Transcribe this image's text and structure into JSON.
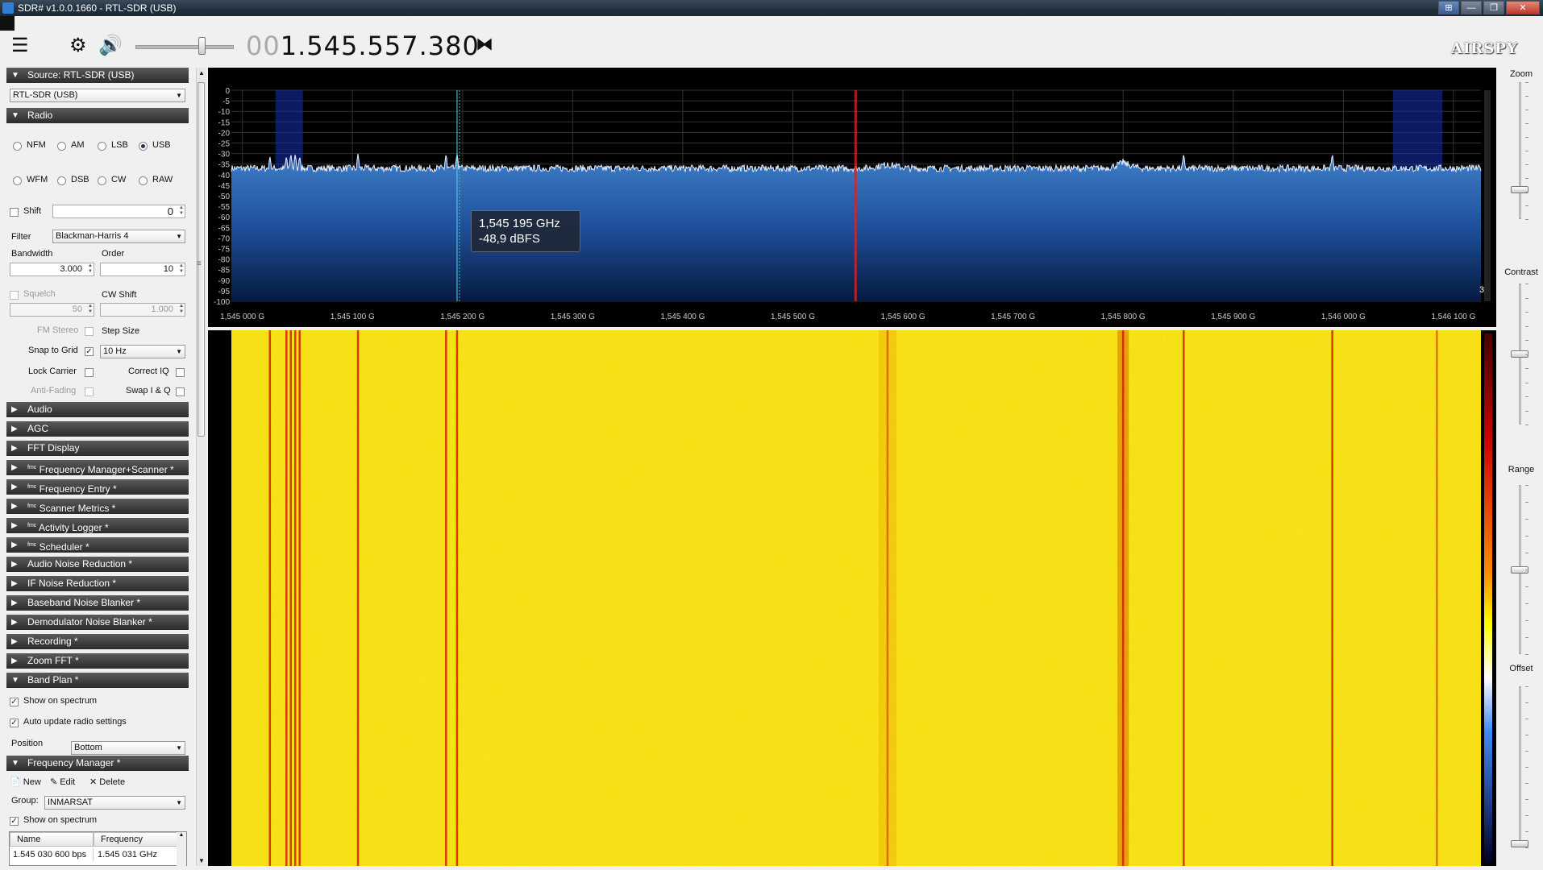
{
  "window": {
    "title": "SDR# v1.0.0.1660 - RTL-SDR (USB)",
    "buttons": {
      "grid": "⊞",
      "minimize": "—",
      "maximize": "❐",
      "close": "✕"
    }
  },
  "toolbar": {
    "frequency_lead": "00",
    "frequency_main": "1.545.557.380",
    "volume_fraction": 0.65,
    "logo": "AIRSPY"
  },
  "source": {
    "header": "Source: RTL-SDR (USB)",
    "device": "RTL-SDR (USB)"
  },
  "radio": {
    "header": "Radio",
    "modes_row1": [
      "NFM",
      "AM",
      "LSB",
      "USB"
    ],
    "modes_row2": [
      "WFM",
      "DSB",
      "CW",
      "RAW"
    ],
    "selected_mode": "USB",
    "shift_label": "Shift",
    "shift_value": "0",
    "filter_label": "Filter",
    "filter_value": "Blackman-Harris 4",
    "bandwidth_label": "Bandwidth",
    "bandwidth_value": "3.000",
    "order_label": "Order",
    "order_value": "10",
    "squelch_label": "Squelch",
    "squelch_value": "50",
    "cw_shift_label": "CW Shift",
    "cw_shift_value": "1.000",
    "fm_stereo_label": "FM Stereo",
    "step_size_label": "Step Size",
    "snap_label": "Snap to Grid",
    "snap_value": "10 Hz",
    "lock_carrier_label": "Lock Carrier",
    "correct_iq_label": "Correct IQ",
    "anti_fading_label": "Anti-Fading",
    "swap_iq_label": "Swap I & Q"
  },
  "sections": [
    {
      "label": "Audio",
      "fmc": false
    },
    {
      "label": "AGC",
      "fmc": false
    },
    {
      "label": "FFT Display",
      "fmc": false
    },
    {
      "label": "Frequency Manager+Scanner *",
      "fmc": true
    },
    {
      "label": "Frequency Entry *",
      "fmc": true
    },
    {
      "label": "Scanner Metrics *",
      "fmc": true
    },
    {
      "label": "Activity Logger *",
      "fmc": true
    },
    {
      "label": "Scheduler *",
      "fmc": true
    },
    {
      "label": "Audio Noise Reduction *",
      "fmc": false
    },
    {
      "label": "IF Noise Reduction *",
      "fmc": false
    },
    {
      "label": "Baseband Noise Blanker *",
      "fmc": false
    },
    {
      "label": "Demodulator Noise Blanker *",
      "fmc": false
    },
    {
      "label": "Recording *",
      "fmc": false
    },
    {
      "label": "Zoom FFT *",
      "fmc": false
    }
  ],
  "fmc_tag": "fmc",
  "band_plan": {
    "header": "Band Plan *",
    "show_on_spectrum": "Show on spectrum",
    "auto_update": "Auto update radio settings",
    "position_label": "Position",
    "position_value": "Bottom"
  },
  "freq_manager": {
    "header": "Frequency Manager *",
    "new": "New",
    "edit": "Edit",
    "delete": "Delete",
    "group_label": "Group:",
    "group_value": "INMARSAT",
    "show_on_spectrum": "Show on spectrum",
    "col_name": "Name",
    "col_frequency": "Frequency",
    "row_name": "1.545 030 600 bps",
    "row_freq": "1.545 031 GHz"
  },
  "right_panel": {
    "zoom": "Zoom",
    "contrast": "Contrast",
    "range": "Range",
    "offset": "Offset",
    "zoom_level": 0.2,
    "contrast_level": 0.5,
    "range_level": 0.5,
    "offset_level": 0.0
  },
  "tooltip": {
    "line1": "1,545 195 GHz",
    "line2": "-48,9 dBFS"
  },
  "range_badge": "3",
  "chart_data": {
    "type": "line",
    "title": "",
    "xlabel": "",
    "ylabel": "",
    "x_ticks": [
      "1,545 000 G",
      "1,545 100 G",
      "1,545 200 G",
      "1,545 300 G",
      "1,545 400 G",
      "1,545 500 G",
      "1,545 600 G",
      "1,545 700 G",
      "1,545 800 G",
      "1,545 900 G",
      "1,546 000 G",
      "1,546 100 G"
    ],
    "y_ticks": [
      "0",
      "-5",
      "-10",
      "-15",
      "-20",
      "-25",
      "-30",
      "-35",
      "-40",
      "-45",
      "-50",
      "-55",
      "-60",
      "-65",
      "-70",
      "-75",
      "-80",
      "-85",
      "-90",
      "-95",
      "-100"
    ],
    "xlim_mhz": [
      1544.99,
      1546.125
    ],
    "ylim": [
      -100,
      0
    ],
    "noise_floor_dbfs": -37,
    "peaks": [
      {
        "x": 1545.025,
        "y": -31
      },
      {
        "x": 1545.04,
        "y": -31
      },
      {
        "x": 1545.044,
        "y": -30
      },
      {
        "x": 1545.048,
        "y": -30
      },
      {
        "x": 1545.052,
        "y": -31
      },
      {
        "x": 1545.105,
        "y": -30
      },
      {
        "x": 1545.185,
        "y": -30
      },
      {
        "x": 1545.195,
        "y": -30
      },
      {
        "x": 1545.586,
        "y": -34
      },
      {
        "x": 1545.8,
        "y": -32
      },
      {
        "x": 1545.855,
        "y": -30
      },
      {
        "x": 1545.99,
        "y": -30
      },
      {
        "x": 1546.085,
        "y": -36
      }
    ],
    "bandplan_regions": [
      {
        "x0": 1545.03,
        "x1": 1545.055
      },
      {
        "x0": 1546.045,
        "x1": 1546.09
      }
    ],
    "tuned_frequency_mhz": 1545.557,
    "cursor_frequency_mhz": 1545.195
  }
}
